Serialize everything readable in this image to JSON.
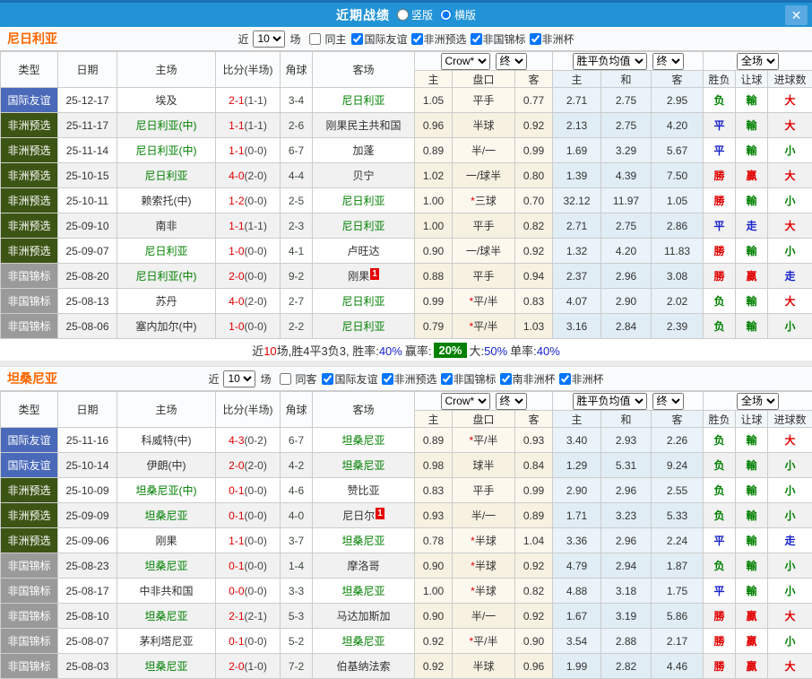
{
  "titlebar": {
    "title": "近期战绩",
    "layout_options": [
      {
        "label": "竖版",
        "checked": false
      },
      {
        "label": "横版",
        "checked": true
      }
    ],
    "close_label": "✕"
  },
  "colors": {
    "titlebar_blue": "#2193d6",
    "type_friendly_blue": "#4a69b9",
    "type_qualifier_green": "#3c5414",
    "type_championship_gray": "#9a9a9a",
    "win_red": "#e10000",
    "draw_blue": "#1822cc",
    "lose_green": "#008000",
    "focal_team_green": "#008000",
    "winrate_badge_green": "#008000",
    "team_title_orange": "#ff6600",
    "crown_col_bg": "#fdf8ee",
    "avg_col_bg": "#e9f3f9"
  },
  "table_header": {
    "type": "类型",
    "date": "日期",
    "home": "主场",
    "score": "比分(半场)",
    "corner": "角球",
    "away": "客场",
    "dd_bookmaker": "Crow*",
    "dd_final1": "终",
    "dd_avg": "胜平负均值",
    "dd_final2": "终",
    "dd_fullmatch": "全场",
    "sub": [
      "主",
      "盘口",
      "客",
      "主",
      "和",
      "客",
      "胜负",
      "让球",
      "进球数"
    ]
  },
  "sections": [
    {
      "team": "尼日利亚",
      "filter": {
        "near": "近",
        "count": "10",
        "games": "场",
        "same_label": "同主",
        "same_checked": false,
        "checks": [
          {
            "label": "国际友谊",
            "checked": true
          },
          {
            "label": "非洲预选",
            "checked": true
          },
          {
            "label": "非国锦标",
            "checked": true
          },
          {
            "label": "非洲杯",
            "checked": true
          }
        ]
      },
      "rows": [
        {
          "t": "国际友谊",
          "tc": "friendly",
          "d": "25-12-17",
          "h": "埃及",
          "hf": false,
          "s": "2-1",
          "sh": "(1-1)",
          "c": "3-4",
          "a": "尼日利亚",
          "af": true,
          "ab": "",
          "o1": "1.05",
          "st": "",
          "hc": "平手",
          "o2": "0.77",
          "m1": "2.71",
          "m2": "2.75",
          "m3": "2.95",
          "r": "负",
          "rc": "green",
          "g1": "輸",
          "g1c": "green",
          "g2": "大",
          "g2c": "red"
        },
        {
          "t": "非洲预选",
          "tc": "afq",
          "d": "25-11-17",
          "h": "尼日利亚(中)",
          "hf": true,
          "s": "1-1",
          "sh": "(1-1)",
          "c": "2-6",
          "a": "刚果民主共和国",
          "af": false,
          "ab": "",
          "o1": "0.96",
          "st": "",
          "hc": "半球",
          "o2": "0.92",
          "m1": "2.13",
          "m2": "2.75",
          "m3": "4.20",
          "r": "平",
          "rc": "blue",
          "g1": "輸",
          "g1c": "green",
          "g2": "大",
          "g2c": "red"
        },
        {
          "t": "非洲预选",
          "tc": "afq",
          "d": "25-11-14",
          "h": "尼日利亚(中)",
          "hf": true,
          "s": "1-1",
          "sh": "(0-0)",
          "c": "6-7",
          "a": "加蓬",
          "af": false,
          "ab": "",
          "o1": "0.89",
          "st": "",
          "hc": "半/一",
          "o2": "0.99",
          "m1": "1.69",
          "m2": "3.29",
          "m3": "5.67",
          "r": "平",
          "rc": "blue",
          "g1": "輸",
          "g1c": "green",
          "g2": "小",
          "g2c": "green"
        },
        {
          "t": "非洲预选",
          "tc": "afq",
          "d": "25-10-15",
          "h": "尼日利亚",
          "hf": true,
          "s": "4-0",
          "sh": "(2-0)",
          "c": "4-4",
          "a": "贝宁",
          "af": false,
          "ab": "",
          "o1": "1.02",
          "st": "",
          "hc": "一/球半",
          "o2": "0.80",
          "m1": "1.39",
          "m2": "4.39",
          "m3": "7.50",
          "r": "勝",
          "rc": "red",
          "g1": "贏",
          "g1c": "red",
          "g2": "大",
          "g2c": "red"
        },
        {
          "t": "非洲预选",
          "tc": "afq",
          "d": "25-10-11",
          "h": "赖索托(中)",
          "hf": false,
          "s": "1-2",
          "sh": "(0-0)",
          "c": "2-5",
          "a": "尼日利亚",
          "af": true,
          "ab": "",
          "o1": "1.00",
          "st": "*",
          "hc": "三球",
          "o2": "0.70",
          "m1": "32.12",
          "m2": "11.97",
          "m3": "1.05",
          "r": "勝",
          "rc": "red",
          "g1": "輸",
          "g1c": "green",
          "g2": "小",
          "g2c": "green"
        },
        {
          "t": "非洲预选",
          "tc": "afq",
          "d": "25-09-10",
          "h": "南非",
          "hf": false,
          "s": "1-1",
          "sh": "(1-1)",
          "c": "2-3",
          "a": "尼日利亚",
          "af": true,
          "ab": "",
          "o1": "1.00",
          "st": "",
          "hc": "平手",
          "o2": "0.82",
          "m1": "2.71",
          "m2": "2.75",
          "m3": "2.86",
          "r": "平",
          "rc": "blue",
          "g1": "走",
          "g1c": "blue",
          "g2": "大",
          "g2c": "red"
        },
        {
          "t": "非洲预选",
          "tc": "afq",
          "d": "25-09-07",
          "h": "尼日利亚",
          "hf": true,
          "s": "1-0",
          "sh": "(0-0)",
          "c": "4-1",
          "a": "卢旺达",
          "af": false,
          "ab": "",
          "o1": "0.90",
          "st": "",
          "hc": "一/球半",
          "o2": "0.92",
          "m1": "1.32",
          "m2": "4.20",
          "m3": "11.83",
          "r": "勝",
          "rc": "red",
          "g1": "輸",
          "g1c": "green",
          "g2": "小",
          "g2c": "green"
        },
        {
          "t": "非国锦标",
          "tc": "chan",
          "d": "25-08-20",
          "h": "尼日利亚(中)",
          "hf": true,
          "s": "2-0",
          "sh": "(0-0)",
          "c": "9-2",
          "a": "刚果",
          "af": false,
          "ab": "1",
          "o1": "0.88",
          "st": "",
          "hc": "平手",
          "o2": "0.94",
          "m1": "2.37",
          "m2": "2.96",
          "m3": "3.08",
          "r": "勝",
          "rc": "red",
          "g1": "贏",
          "g1c": "red",
          "g2": "走",
          "g2c": "blue"
        },
        {
          "t": "非国锦标",
          "tc": "chan",
          "d": "25-08-13",
          "h": "苏丹",
          "hf": false,
          "s": "4-0",
          "sh": "(2-0)",
          "c": "2-7",
          "a": "尼日利亚",
          "af": true,
          "ab": "",
          "o1": "0.99",
          "st": "*",
          "hc": "平/半",
          "o2": "0.83",
          "m1": "4.07",
          "m2": "2.90",
          "m3": "2.02",
          "r": "负",
          "rc": "green",
          "g1": "輸",
          "g1c": "green",
          "g2": "大",
          "g2c": "red"
        },
        {
          "t": "非国锦标",
          "tc": "chan",
          "d": "25-08-06",
          "h": "塞内加尔(中)",
          "hf": false,
          "s": "1-0",
          "sh": "(0-0)",
          "c": "2-2",
          "a": "尼日利亚",
          "af": true,
          "ab": "",
          "o1": "0.79",
          "st": "*",
          "hc": "平/半",
          "o2": "1.03",
          "m1": "3.16",
          "m2": "2.84",
          "m3": "2.39",
          "r": "负",
          "rc": "green",
          "g1": "輸",
          "g1c": "green",
          "g2": "小",
          "g2c": "green"
        }
      ],
      "summary": {
        "pre": "近",
        "n": "10",
        "post": "场,胜4平3负3, 胜率:",
        "rate": "40%",
        "win_label": "赢率:",
        "win_badge": "20%",
        "big_label": "大:",
        "big": "50%",
        "single_label": "单率:",
        "single": "40%"
      }
    },
    {
      "team": "坦桑尼亚",
      "filter": {
        "near": "近",
        "count": "10",
        "games": "场",
        "same_label": "同客",
        "same_checked": false,
        "checks": [
          {
            "label": "国际友谊",
            "checked": true
          },
          {
            "label": "非洲预选",
            "checked": true
          },
          {
            "label": "非国锦标",
            "checked": true
          },
          {
            "label": "南非洲杯",
            "checked": true
          },
          {
            "label": "非洲杯",
            "checked": true
          }
        ]
      },
      "rows": [
        {
          "t": "国际友谊",
          "tc": "friendly",
          "d": "25-11-16",
          "h": "科威特(中)",
          "hf": false,
          "s": "4-3",
          "sh": "(0-2)",
          "c": "6-7",
          "a": "坦桑尼亚",
          "af": true,
          "ab": "",
          "o1": "0.89",
          "st": "*",
          "hc": "平/半",
          "o2": "0.93",
          "m1": "3.40",
          "m2": "2.93",
          "m3": "2.26",
          "r": "负",
          "rc": "green",
          "g1": "輸",
          "g1c": "green",
          "g2": "大",
          "g2c": "red"
        },
        {
          "t": "国际友谊",
          "tc": "friendly",
          "d": "25-10-14",
          "h": "伊朗(中)",
          "hf": false,
          "s": "2-0",
          "sh": "(2-0)",
          "c": "4-2",
          "a": "坦桑尼亚",
          "af": true,
          "ab": "",
          "o1": "0.98",
          "st": "",
          "hc": "球半",
          "o2": "0.84",
          "m1": "1.29",
          "m2": "5.31",
          "m3": "9.24",
          "r": "负",
          "rc": "green",
          "g1": "輸",
          "g1c": "green",
          "g2": "小",
          "g2c": "green"
        },
        {
          "t": "非洲预选",
          "tc": "afq",
          "d": "25-10-09",
          "h": "坦桑尼亚(中)",
          "hf": true,
          "s": "0-1",
          "sh": "(0-0)",
          "c": "4-6",
          "a": "赞比亚",
          "af": false,
          "ab": "",
          "o1": "0.83",
          "st": "",
          "hc": "平手",
          "o2": "0.99",
          "m1": "2.90",
          "m2": "2.96",
          "m3": "2.55",
          "r": "负",
          "rc": "green",
          "g1": "輸",
          "g1c": "green",
          "g2": "小",
          "g2c": "green"
        },
        {
          "t": "非洲预选",
          "tc": "afq",
          "d": "25-09-09",
          "h": "坦桑尼亚",
          "hf": true,
          "s": "0-1",
          "sh": "(0-0)",
          "c": "4-0",
          "a": "尼日尔",
          "af": false,
          "ab": "1",
          "o1": "0.93",
          "st": "",
          "hc": "半/一",
          "o2": "0.89",
          "m1": "1.71",
          "m2": "3.23",
          "m3": "5.33",
          "r": "负",
          "rc": "green",
          "g1": "輸",
          "g1c": "green",
          "g2": "小",
          "g2c": "green"
        },
        {
          "t": "非洲预选",
          "tc": "afq",
          "d": "25-09-06",
          "h": "刚果",
          "hf": false,
          "s": "1-1",
          "sh": "(0-0)",
          "c": "3-7",
          "a": "坦桑尼亚",
          "af": true,
          "ab": "",
          "o1": "0.78",
          "st": "*",
          "hc": "半球",
          "o2": "1.04",
          "m1": "3.36",
          "m2": "2.96",
          "m3": "2.24",
          "r": "平",
          "rc": "blue",
          "g1": "輸",
          "g1c": "green",
          "g2": "走",
          "g2c": "blue"
        },
        {
          "t": "非国锦标",
          "tc": "chan",
          "d": "25-08-23",
          "h": "坦桑尼亚",
          "hf": true,
          "s": "0-1",
          "sh": "(0-0)",
          "c": "1-4",
          "a": "摩洛哥",
          "af": false,
          "ab": "",
          "o1": "0.90",
          "st": "*",
          "hc": "半球",
          "o2": "0.92",
          "m1": "4.79",
          "m2": "2.94",
          "m3": "1.87",
          "r": "负",
          "rc": "green",
          "g1": "輸",
          "g1c": "green",
          "g2": "小",
          "g2c": "green"
        },
        {
          "t": "非国锦标",
          "tc": "chan",
          "d": "25-08-17",
          "h": "中非共和国",
          "hf": false,
          "s": "0-0",
          "sh": "(0-0)",
          "c": "3-3",
          "a": "坦桑尼亚",
          "af": true,
          "ab": "",
          "o1": "1.00",
          "st": "*",
          "hc": "半球",
          "o2": "0.82",
          "m1": "4.88",
          "m2": "3.18",
          "m3": "1.75",
          "r": "平",
          "rc": "blue",
          "g1": "輸",
          "g1c": "green",
          "g2": "小",
          "g2c": "green"
        },
        {
          "t": "非国锦标",
          "tc": "chan",
          "d": "25-08-10",
          "h": "坦桑尼亚",
          "hf": true,
          "s": "2-1",
          "sh": "(2-1)",
          "c": "5-3",
          "a": "马达加斯加",
          "af": false,
          "ab": "",
          "o1": "0.90",
          "st": "",
          "hc": "半/一",
          "o2": "0.92",
          "m1": "1.67",
          "m2": "3.19",
          "m3": "5.86",
          "r": "勝",
          "rc": "red",
          "g1": "贏",
          "g1c": "red",
          "g2": "大",
          "g2c": "red"
        },
        {
          "t": "非国锦标",
          "tc": "chan",
          "d": "25-08-07",
          "h": "茅利塔尼亚",
          "hf": false,
          "s": "0-1",
          "sh": "(0-0)",
          "c": "5-2",
          "a": "坦桑尼亚",
          "af": true,
          "ab": "",
          "o1": "0.92",
          "st": "*",
          "hc": "平/半",
          "o2": "0.90",
          "m1": "3.54",
          "m2": "2.88",
          "m3": "2.17",
          "r": "勝",
          "rc": "red",
          "g1": "贏",
          "g1c": "red",
          "g2": "小",
          "g2c": "green"
        },
        {
          "t": "非国锦标",
          "tc": "chan",
          "d": "25-08-03",
          "h": "坦桑尼亚",
          "hf": true,
          "s": "2-0",
          "sh": "(1-0)",
          "c": "7-2",
          "a": "伯基纳法索",
          "af": false,
          "ab": "",
          "o1": "0.92",
          "st": "",
          "hc": "半球",
          "o2": "0.96",
          "m1": "1.99",
          "m2": "2.82",
          "m3": "4.46",
          "r": "勝",
          "rc": "red",
          "g1": "贏",
          "g1c": "red",
          "g2": "大",
          "g2c": "red"
        }
      ]
    }
  ]
}
